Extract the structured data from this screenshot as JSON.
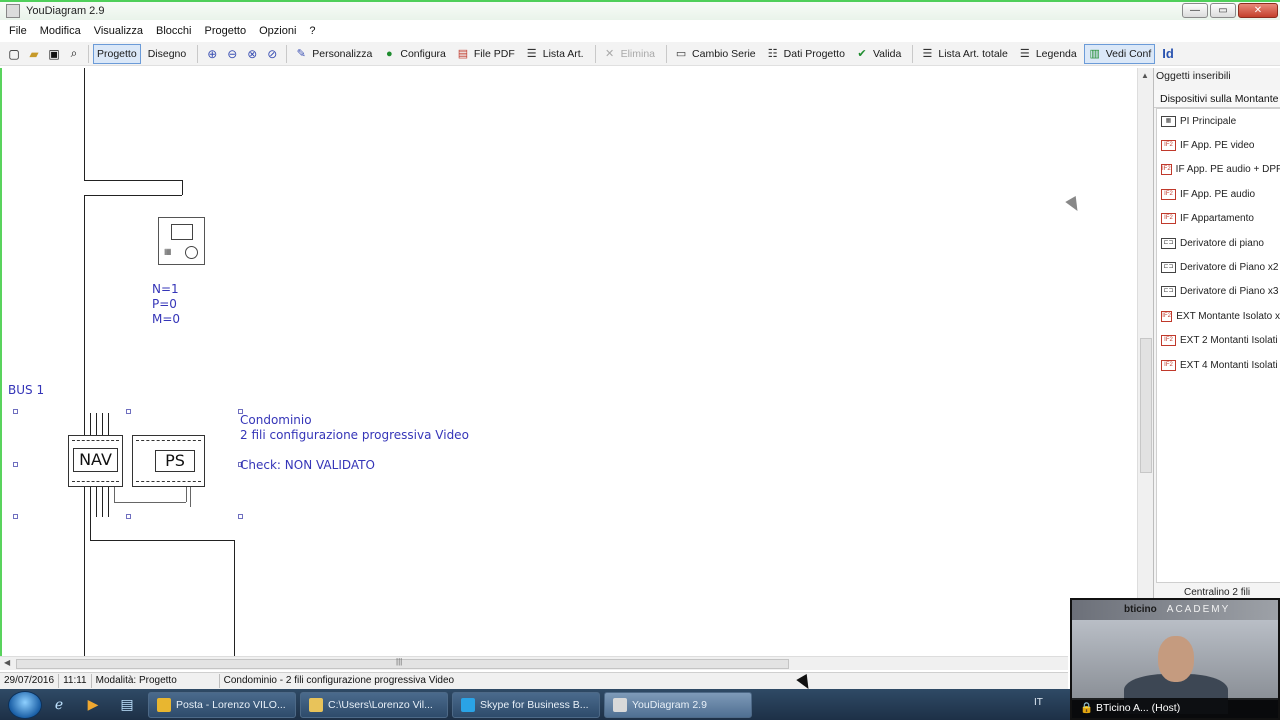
{
  "window": {
    "title": "YouDiagram 2.9",
    "controls": {
      "minimize": "—",
      "maximize": "▭",
      "close": "✕"
    }
  },
  "menu": [
    "File",
    "Modifica",
    "Visualizza",
    "Blocchi",
    "Progetto",
    "Opzioni",
    "?"
  ],
  "toolbar": {
    "left_icons": [
      "new-icon",
      "open-icon",
      "save-icon",
      "print-preview-icon"
    ],
    "mode_buttons": [
      {
        "label": "Progetto",
        "active": true
      },
      {
        "label": "Disegno",
        "active": false
      }
    ],
    "zoom_icons": [
      "zoom-in-icon",
      "zoom-out-icon",
      "zoom-fit-icon",
      "zoom-reset-icon"
    ],
    "buttons": [
      {
        "label": "Personalizza",
        "icon": "pencil-icon",
        "glyph": "✎",
        "color": "#3a4fb3",
        "disabled": false,
        "active": false
      },
      {
        "label": "Configura",
        "icon": "configure-icon",
        "glyph": "●",
        "color": "#1e8c2e",
        "disabled": false,
        "active": false
      },
      {
        "label": "File PDF",
        "icon": "pdf-icon",
        "glyph": "▤",
        "color": "#c0392b",
        "disabled": false,
        "active": false
      },
      {
        "label": "Lista Art.",
        "icon": "list-icon",
        "glyph": "☰",
        "color": "#333333",
        "disabled": false,
        "active": false
      },
      {
        "label": "Elimina",
        "icon": "delete-icon",
        "glyph": "✕",
        "color": "#a9a9a9",
        "disabled": true,
        "active": false
      },
      {
        "label": "Cambio Serie",
        "icon": "series-icon",
        "glyph": "▭",
        "color": "#333333",
        "disabled": false,
        "active": false
      },
      {
        "label": "Dati Progetto",
        "icon": "project-data-icon",
        "glyph": "☷",
        "color": "#333333",
        "disabled": false,
        "active": false
      },
      {
        "label": "Valida",
        "icon": "check-icon",
        "glyph": "✔",
        "color": "#1e8c2e",
        "disabled": false,
        "active": false
      },
      {
        "label": "Lista Art. totale",
        "icon": "list-total-icon",
        "glyph": "☰",
        "color": "#333333",
        "disabled": false,
        "active": false
      },
      {
        "label": "Legenda",
        "icon": "legend-icon",
        "glyph": "☰",
        "color": "#333333",
        "disabled": false,
        "active": false
      },
      {
        "label": "Vedi Conf",
        "icon": "view-config-icon",
        "glyph": "▥",
        "color": "#1e8c2e",
        "disabled": false,
        "active": true
      }
    ],
    "last_button": {
      "label": "Id",
      "icon": "id-icon"
    }
  },
  "diagram": {
    "device_counts": [
      "N=1",
      "P=0",
      "M=0"
    ],
    "bus_label": "BUS 1",
    "nav_label": "NAV",
    "ps_label": "PS",
    "project_title": "Condominio",
    "project_subtitle": "2 fili configurazione progressiva Video",
    "check_status": "Check: NON VALIDATO"
  },
  "panel": {
    "title": "Oggetti inseribili",
    "subheader": "Dispositivi sulla Montante",
    "items": [
      {
        "label": "PI Principale",
        "icon": "panel-icon",
        "icon_text": "▦"
      },
      {
        "label": "IF App. PE video",
        "icon": "interface-icon",
        "icon_text": "IF2"
      },
      {
        "label": "IF App. PE audio + DPP",
        "icon": "interface-icon",
        "icon_text": "IF2"
      },
      {
        "label": "IF App. PE audio",
        "icon": "interface-icon",
        "icon_text": "IF2"
      },
      {
        "label": "IF Appartamento",
        "icon": "interface-icon",
        "icon_text": "IF2"
      },
      {
        "label": "Derivatore di piano",
        "icon": "floor-splitter-icon",
        "icon_text": "⊏⊐"
      },
      {
        "label": "Derivatore di Piano x2",
        "icon": "floor-splitter-icon",
        "icon_text": "⊏⊐"
      },
      {
        "label": "Derivatore di Piano x3",
        "icon": "floor-splitter-icon",
        "icon_text": "⊏⊐"
      },
      {
        "label": "EXT Montante Isolato x",
        "icon": "interface-icon",
        "icon_text": "IF2"
      },
      {
        "label": "EXT 2 Montanti Isolati",
        "icon": "interface-icon",
        "icon_text": "IF2"
      },
      {
        "label": "EXT 4 Montanti Isolati",
        "icon": "interface-icon",
        "icon_text": "IF2"
      }
    ],
    "footer": "Centralino 2 fili"
  },
  "status": {
    "date": "29/07/2016",
    "time": "11:11",
    "mode": "Modalità: Progetto",
    "project": "Condominio - 2 fili configurazione progressiva Video"
  },
  "taskbar": {
    "items": [
      {
        "label": "Posta - Lorenzo VILO...",
        "icon": "chrome-icon",
        "color": "#e8b630",
        "active": false
      },
      {
        "label": "C:\\Users\\Lorenzo Vil...",
        "icon": "folder-icon",
        "color": "#e8c35a",
        "active": false
      },
      {
        "label": "Skype for Business B...",
        "icon": "skype-icon",
        "color": "#2aa3e6",
        "active": false
      },
      {
        "label": "YouDiagram 2.9",
        "icon": "app-icon",
        "color": "#d9d9d9",
        "active": true
      }
    ],
    "language": "IT"
  },
  "webcam": {
    "brand": "bticino",
    "banner_text": "ACADEMY",
    "caption": "BTicino A... (Host)"
  },
  "colors": {
    "accent_green": "#59d35d",
    "diagram_text": "#3535b8",
    "active_blue": "#6b9bd8"
  }
}
